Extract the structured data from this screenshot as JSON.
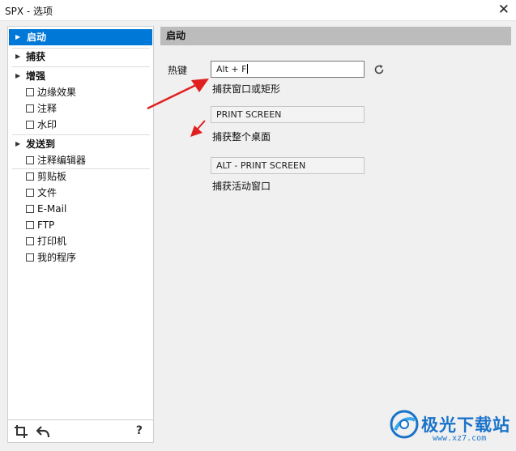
{
  "window": {
    "title": "SPX - 选项",
    "close_icon": "close-icon"
  },
  "sidebar": {
    "sections": [
      {
        "label": "启动",
        "selected": true
      },
      {
        "label": "捕获",
        "selected": false
      },
      {
        "label": "增强",
        "selected": false
      },
      {
        "label": "发送到",
        "selected": false
      }
    ],
    "enhance_items": [
      "边缘效果",
      "注释",
      "水印"
    ],
    "sendto_items": [
      "注释编辑器",
      "剪贴板",
      "文件",
      "E-Mail",
      "FTP",
      "打印机",
      "我的程序"
    ],
    "bottom": {
      "crop_icon": "crop-icon",
      "undo_icon": "undo-arrow-icon",
      "help_label": "?"
    }
  },
  "content": {
    "header": "启动",
    "hotkey_label": "热键",
    "hotkey_value": "Alt + F",
    "refresh_icon": "refresh-icon",
    "capture_window_label": "捕获窗口或矩形",
    "print_screen_value": "PRINT SCREEN",
    "capture_desktop_label": "捕获整个桌面",
    "alt_print_screen_value": "ALT - PRINT SCREEN",
    "capture_active_label": "捕获活动窗口"
  },
  "annotations": {
    "arrow_color": "#e02020"
  },
  "watermark": {
    "text": "极光下载站",
    "url": "www.xz7.com"
  }
}
